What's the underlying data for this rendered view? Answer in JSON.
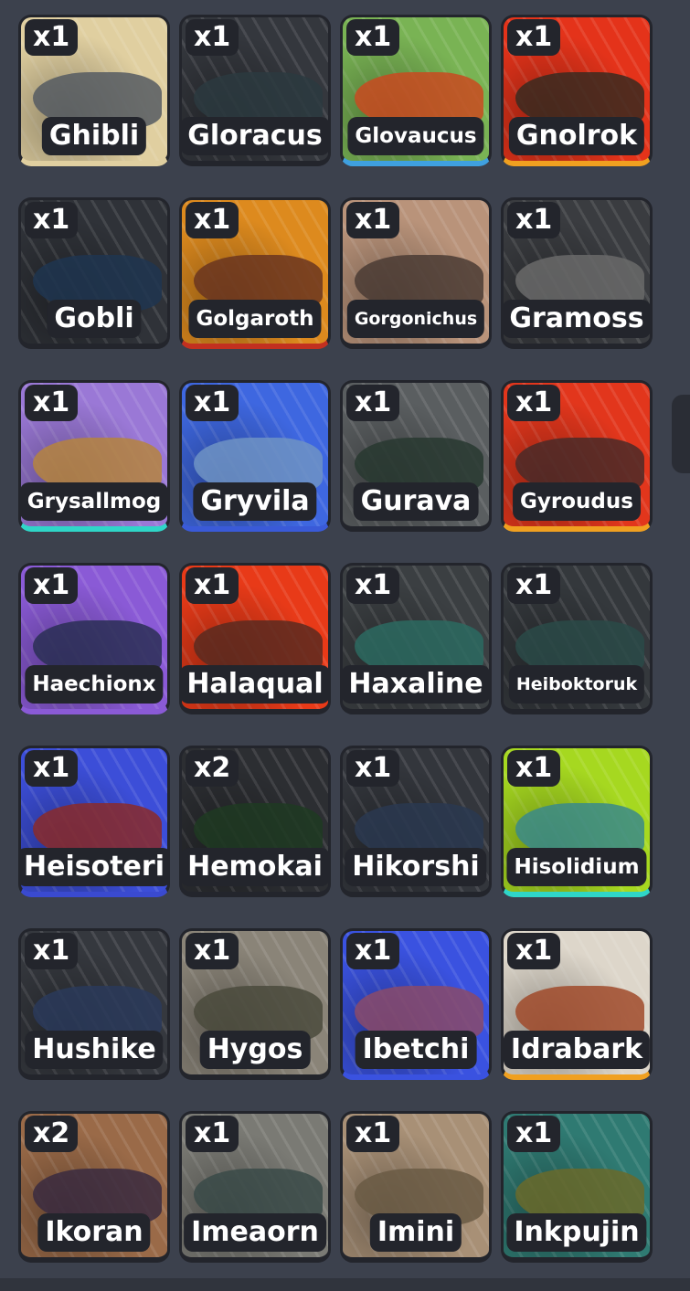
{
  "inventory": {
    "items": [
      {
        "count": "x1",
        "name": "Ghibli",
        "bg": "#e0cfa0",
        "fg": "#555a62",
        "rim": "#e0cfa0"
      },
      {
        "count": "x1",
        "name": "Gloracus",
        "bg": "#34373d",
        "fg": "#2b3a40",
        "rim": "#23252c"
      },
      {
        "count": "x1",
        "name": "Glovaucus",
        "bg": "#79b354",
        "fg": "#c94a20",
        "rim": "#3fa0e0"
      },
      {
        "count": "x1",
        "name": "Gnolrok",
        "bg": "#e4331a",
        "fg": "#3a2a20",
        "rim": "#f0a020"
      },
      {
        "count": "x1",
        "name": "Gobli",
        "bg": "#2f3238",
        "fg": "#1f3550",
        "rim": "#23252c"
      },
      {
        "count": "x1",
        "name": "Golgaroth",
        "bg": "#dd8a1e",
        "fg": "#6a3520",
        "rim": "#c23020"
      },
      {
        "count": "x1",
        "name": "Gorgonichus",
        "bg": "#b9937a",
        "fg": "#4a3b34",
        "rim": "#23252c"
      },
      {
        "count": "x1",
        "name": "Gramoss",
        "bg": "#3a3c40",
        "fg": "#6a6a6a",
        "rim": "#23252c"
      },
      {
        "count": "x1",
        "name": "Grysallmog",
        "bg": "#9a78d6",
        "fg": "#b5843e",
        "rim": "#2fd6c8"
      },
      {
        "count": "x1",
        "name": "Gryvila",
        "bg": "#3e67e0",
        "fg": "#6f93c4",
        "rim": "#3a5ad8"
      },
      {
        "count": "x1",
        "name": "Gurava",
        "bg": "#5a5e60",
        "fg": "#283830",
        "rim": "#23252c"
      },
      {
        "count": "x1",
        "name": "Gyroudus",
        "bg": "#e2361c",
        "fg": "#4a2a28",
        "rim": "#f0a020"
      },
      {
        "count": "x1",
        "name": "Haechionx",
        "bg": "#8a5ad6",
        "fg": "#2a2f55",
        "rim": "#8a5ad6"
      },
      {
        "count": "x1",
        "name": "Halaqual",
        "bg": "#e83a18",
        "fg": "#5a2a20",
        "rim": "#23252c"
      },
      {
        "count": "x1",
        "name": "Haxaline",
        "bg": "#3b3f42",
        "fg": "#2c6a60",
        "rim": "#23252c"
      },
      {
        "count": "x1",
        "name": "Heiboktoruk",
        "bg": "#34383c",
        "fg": "#2a4a48",
        "rim": "#23252c"
      },
      {
        "count": "x1",
        "name": "Heisoteri",
        "bg": "#3c4ed8",
        "fg": "#8a2a2a",
        "rim": "#3a4ad0"
      },
      {
        "count": "x2",
        "name": "Hemokai",
        "bg": "#2c2e32",
        "fg": "#1f3a22",
        "rim": "#23252c"
      },
      {
        "count": "x1",
        "name": "Hikorshi",
        "bg": "#33363c",
        "fg": "#2a3850",
        "rim": "#23252c"
      },
      {
        "count": "x1",
        "name": "Hisolidium",
        "bg": "#a6d820",
        "fg": "#3a8a8a",
        "rim": "#2fd6c8"
      },
      {
        "count": "x1",
        "name": "Hushike",
        "bg": "#35383e",
        "fg": "#2a3a5a",
        "rim": "#23252c"
      },
      {
        "count": "x1",
        "name": "Hygos",
        "bg": "#8a8478",
        "fg": "#4a4a3c",
        "rim": "#23252c"
      },
      {
        "count": "x1",
        "name": "Ibetchi",
        "bg": "#3a52e0",
        "fg": "#8a4a6a",
        "rim": "#3a52e0"
      },
      {
        "count": "x1",
        "name": "Idrabark",
        "bg": "#ddd6ca",
        "fg": "#a04a2a",
        "rim": "#f0a020"
      },
      {
        "count": "x2",
        "name": "Ikoran",
        "bg": "#9a6a48",
        "fg": "#3a2a40",
        "rim": "#23252c"
      },
      {
        "count": "x1",
        "name": "Imeaorn",
        "bg": "#7a7a74",
        "fg": "#3a4a48",
        "rim": "#23252c"
      },
      {
        "count": "x1",
        "name": "Imini",
        "bg": "#a89076",
        "fg": "#6a5a44",
        "rim": "#23252c"
      },
      {
        "count": "x1",
        "name": "Inkpujin",
        "bg": "#2f7a72",
        "fg": "#6a6a2a",
        "rim": "#23252c"
      }
    ]
  }
}
